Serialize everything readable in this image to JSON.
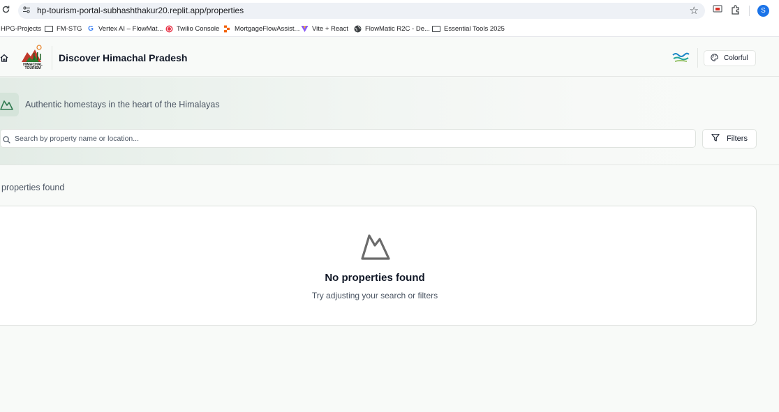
{
  "browser": {
    "url": "hp-tourism-portal-subhashthakur20.replit.app/properties",
    "profile_initial": "S",
    "bookmarks": [
      {
        "label": "HPG-Projects",
        "icon": "none"
      },
      {
        "label": "FM-STG",
        "icon": "folder-icon"
      },
      {
        "label": "Vertex AI – FlowMat...",
        "icon": "google-icon"
      },
      {
        "label": "Twilio Console",
        "icon": "twilio-icon"
      },
      {
        "label": "MortgageFlowAssist...",
        "icon": "replit-icon"
      },
      {
        "label": "Vite + React",
        "icon": "vite-icon"
      },
      {
        "label": "FlowMatic R2C - De...",
        "icon": "globe-icon"
      },
      {
        "label": "Essential Tools 2025",
        "icon": "folder-icon"
      }
    ]
  },
  "header": {
    "logo_text_line1": "HIMACHAL",
    "logo_text_line2": "TOURISM",
    "title": "Discover Himachal Pradesh",
    "theme_label": "Colorful"
  },
  "hero": {
    "tagline": "Authentic homestays in the heart of the Himalayas",
    "search_placeholder": "Search by property name or location...",
    "filters_label": "Filters"
  },
  "results": {
    "count_text": "properties found",
    "empty_title": "No properties found",
    "empty_subtitle": "Try adjusting your search or filters"
  },
  "colors": {
    "accent_green": "#2f7a4f",
    "brand_red": "#c0392b"
  }
}
